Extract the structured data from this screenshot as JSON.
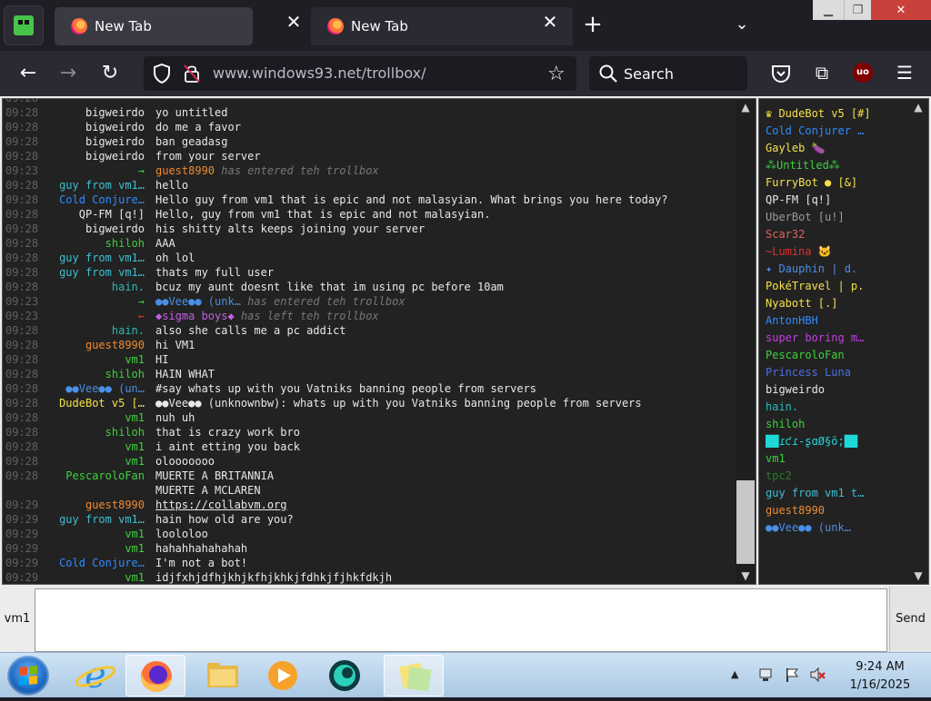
{
  "browser": {
    "tabs": [
      {
        "title": "New Tab"
      },
      {
        "title": "New Tab"
      }
    ],
    "url_domain": "www.windows93.net",
    "url_path": "/trollbox/",
    "search_placeholder": "Search"
  },
  "chat": {
    "messages": [
      {
        "time": "09:28",
        "nick": "bigweirdo",
        "nick_color": "#e8e8e8",
        "text": "yo untitled",
        "kind": "normal"
      },
      {
        "time": "09:28",
        "nick": "bigweirdo",
        "nick_color": "#e8e8e8",
        "text": "do me a favor",
        "kind": "normal"
      },
      {
        "time": "09:28",
        "nick": "bigweirdo",
        "nick_color": "#e8e8e8",
        "text": "ban geadasg",
        "kind": "normal"
      },
      {
        "time": "09:28",
        "nick": "bigweirdo",
        "nick_color": "#e8e8e8",
        "text": "from your server",
        "kind": "normal"
      },
      {
        "time": "09:23",
        "nick": "→",
        "nick_color": "#3dd13d",
        "text": "guest8990 has entered teh trollbox",
        "kind": "join",
        "who": "guest8990",
        "who_color": "#f08a30",
        "action": "has entered teh trollbox"
      },
      {
        "time": "09:28",
        "nick": "guy from vm1…",
        "nick_color": "#3fbfd0",
        "text": "hello",
        "kind": "normal"
      },
      {
        "time": "09:28",
        "nick": "Cold Conjure…",
        "nick_color": "#2f8cff",
        "text": "Hello guy from vm1 that is epic and not malasyian. What brings you here today?",
        "kind": "normal"
      },
      {
        "time": "09:28",
        "nick": "QP-FM [q!]",
        "nick_color": "#e8e8e8",
        "text": "Hello, guy from vm1 that is epic and not malasyian.",
        "kind": "normal"
      },
      {
        "time": "09:28",
        "nick": "bigweirdo",
        "nick_color": "#e8e8e8",
        "text": "his shitty alts keeps joining your server",
        "kind": "normal"
      },
      {
        "time": "09:28",
        "nick": "shiloh",
        "nick_color": "#3dd13d",
        "text": "AAA",
        "kind": "normal"
      },
      {
        "time": "09:28",
        "nick": "guy from vm1…",
        "nick_color": "#3fbfd0",
        "text": "oh lol",
        "kind": "normal"
      },
      {
        "time": "09:28",
        "nick": "guy from vm1…",
        "nick_color": "#3fbfd0",
        "text": "thats my full user",
        "kind": "normal"
      },
      {
        "time": "09:28",
        "nick": "hain.",
        "nick_color": "#2fb8b8",
        "text": "bcuz my aunt doesnt like that im using pc before 10am",
        "kind": "normal"
      },
      {
        "time": "09:23",
        "nick": "→",
        "nick_color": "#3dd13d",
        "text": "●●Vee●● (unk… has entered teh trollbox",
        "kind": "join",
        "who": "●●Vee●● (unk…",
        "who_color": "#4a8fe8",
        "action": "has entered teh trollbox"
      },
      {
        "time": "09:23",
        "nick": "←",
        "nick_color": "#e03030",
        "text": "◆sigma boys◆ has left teh trollbox",
        "kind": "join",
        "who": "◆sigma boys◆",
        "who_color": "#c060e0",
        "action": "has left teh trollbox"
      },
      {
        "time": "09:28",
        "nick": "hain.",
        "nick_color": "#2fb8b8",
        "text": "also she calls me a pc addict",
        "kind": "normal"
      },
      {
        "time": "09:28",
        "nick": "guest8990",
        "nick_color": "#f08a30",
        "text": "hi VM1",
        "kind": "normal"
      },
      {
        "time": "09:28",
        "nick": "vm1",
        "nick_color": "#3dd13d",
        "text": "HI",
        "kind": "normal"
      },
      {
        "time": "09:28",
        "nick": "shiloh",
        "nick_color": "#3dd13d",
        "text": "HAIN WHAT",
        "kind": "normal"
      },
      {
        "time": "09:28",
        "nick": "●●Vee●● (un…",
        "nick_color": "#4a8fe8",
        "text": "#say whats up with you Vatniks banning people from servers",
        "kind": "normal"
      },
      {
        "time": "09:28",
        "nick": "DudeBot v5 […",
        "nick_color": "#f5e04a",
        "text": "●●Vee●● (unknownbw): whats up with you Vatniks banning people from servers",
        "kind": "normal"
      },
      {
        "time": "09:28",
        "nick": "vm1",
        "nick_color": "#3dd13d",
        "text": "nuh uh",
        "kind": "normal"
      },
      {
        "time": "09:28",
        "nick": "shiloh",
        "nick_color": "#3dd13d",
        "text": "that is crazy work bro",
        "kind": "normal"
      },
      {
        "time": "09:28",
        "nick": "vm1",
        "nick_color": "#3dd13d",
        "text": "i aint etting you back",
        "kind": "normal"
      },
      {
        "time": "09:28",
        "nick": "vm1",
        "nick_color": "#3dd13d",
        "text": "olooooooo",
        "kind": "normal"
      },
      {
        "time": "09:28",
        "nick": "PescaroloFan",
        "nick_color": "#3dd13d",
        "text": "MUERTE A BRITANNIA",
        "kind": "normal"
      },
      {
        "time": "",
        "nick": "",
        "nick_color": "#3dd13d",
        "text": "MUERTE A MCLAREN",
        "kind": "normal"
      },
      {
        "time": "09:29",
        "nick": "guest8990",
        "nick_color": "#f08a30",
        "text": "https://collabvm.org",
        "kind": "link"
      },
      {
        "time": "09:29",
        "nick": "guy from vm1…",
        "nick_color": "#3fbfd0",
        "text": "hain how old are you?",
        "kind": "normal"
      },
      {
        "time": "09:29",
        "nick": "vm1",
        "nick_color": "#3dd13d",
        "text": "loololoo",
        "kind": "normal"
      },
      {
        "time": "09:29",
        "nick": "vm1",
        "nick_color": "#3dd13d",
        "text": "hahahhahahahah",
        "kind": "normal"
      },
      {
        "time": "09:29",
        "nick": "Cold Conjure…",
        "nick_color": "#2f8cff",
        "text": "I'm not a bot!",
        "kind": "normal"
      },
      {
        "time": "09:29",
        "nick": "vm1",
        "nick_color": "#3dd13d",
        "text": "idjfxhjdfhjkhjkfhjkhkjfdhkjfjhkfdkjh",
        "kind": "normal"
      }
    ],
    "partial_top_line": "09:28"
  },
  "users": [
    {
      "name": "♛ DudeBot v5 [#]",
      "color": "#f5e04a"
    },
    {
      "name": "Cold Conjurer …",
      "color": "#2f8cff"
    },
    {
      "name": "Gayleb 🍆",
      "color": "#f5e04a"
    },
    {
      "name": "⁂Untitled⁂",
      "color": "#3dd13d"
    },
    {
      "name": "FurryBot ● [&]",
      "color": "#f5e04a"
    },
    {
      "name": "QP-FM [q!]",
      "color": "#e8e8e8"
    },
    {
      "name": "UberBot [u!]",
      "color": "#9a9a9a"
    },
    {
      "name": "Scar32",
      "color": "#e06060"
    },
    {
      "name": "~Lumina 🐱",
      "color": "#e03030"
    },
    {
      "name": "✦ Dauphin | d.",
      "color": "#4a8fe8"
    },
    {
      "name": "PokéTravel | p.",
      "color": "#f5e04a"
    },
    {
      "name": "Nyabott [.]",
      "color": "#f5e04a"
    },
    {
      "name": "AntonHBH",
      "color": "#2f8cff"
    },
    {
      "name": "super boring m…",
      "color": "#c040e0"
    },
    {
      "name": "PescaroloFan",
      "color": "#3dd13d"
    },
    {
      "name": "Princess Luna",
      "color": "#4a6fe8"
    },
    {
      "name": "bigweirdo",
      "color": "#e8e8e8"
    },
    {
      "name": "hain.",
      "color": "#2fb8b8"
    },
    {
      "name": "shiloh",
      "color": "#3dd13d"
    },
    {
      "name": "██ɾƈɾ-ʂɑØ§ō;██",
      "color": "#1fd8d8"
    },
    {
      "name": "vm1",
      "color": "#3dd13d"
    },
    {
      "name": "tpc2",
      "color": "#2a7a2a"
    },
    {
      "name": "guy from vm1 t…",
      "color": "#3fbfd0"
    },
    {
      "name": "guest8990",
      "color": "#f08a30"
    },
    {
      "name": "●●Vee●● (unk…",
      "color": "#4a8fe8"
    }
  ],
  "input": {
    "nick": "vm1",
    "value": "",
    "send_label": "Send"
  },
  "taskbar": {
    "time": "9:24 AM",
    "date": "1/16/2025"
  }
}
